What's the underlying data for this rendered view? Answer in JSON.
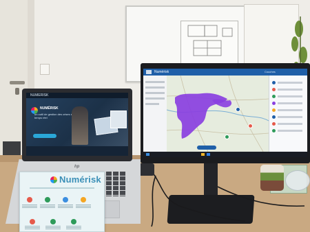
{
  "laptop": {
    "brand_text": "hp",
    "site_brand": "NUMERISK",
    "hero_heading": "NUMÉRISK",
    "hero_tagline": "un outil de gestion des crises en temps réel"
  },
  "flyer": {
    "title": "Numérisk"
  },
  "monitor": {
    "app_title": "Numérisk",
    "panel_title": "Couches"
  },
  "colors": {
    "flood_area": "#8a3fe0",
    "map_background": "#e6ecde",
    "app_header": "#1f5fa8",
    "desk": "#c9a982"
  }
}
